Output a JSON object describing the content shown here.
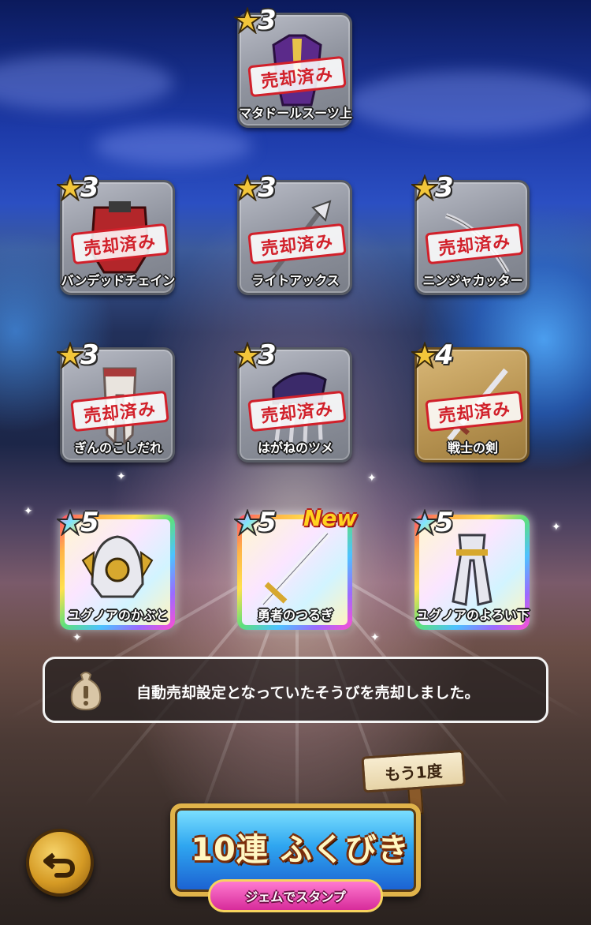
{
  "items": [
    {
      "id": "i0",
      "name": "マタドールスーツ上",
      "rarity": "3",
      "sold": true,
      "tier": "silver"
    },
    {
      "id": "i1",
      "name": "バンデッドチェイン",
      "rarity": "3",
      "sold": true,
      "tier": "silver"
    },
    {
      "id": "i2",
      "name": "ライトアックス",
      "rarity": "3",
      "sold": true,
      "tier": "silver"
    },
    {
      "id": "i3",
      "name": "ニンジャカッター",
      "rarity": "3",
      "sold": true,
      "tier": "silver"
    },
    {
      "id": "i4",
      "name": "ぎんのこしだれ",
      "rarity": "3",
      "sold": true,
      "tier": "silver"
    },
    {
      "id": "i5",
      "name": "はがねのツメ",
      "rarity": "3",
      "sold": true,
      "tier": "silver"
    },
    {
      "id": "i6",
      "name": "戦士の剣",
      "rarity": "4",
      "sold": true,
      "tier": "gold"
    },
    {
      "id": "i7",
      "name": "ユグノアのかぶと",
      "rarity": "5",
      "sold": false,
      "tier": "rainbow"
    },
    {
      "id": "i8",
      "name": "勇者のつるぎ",
      "rarity": "5",
      "sold": false,
      "tier": "rainbow",
      "new": "New"
    },
    {
      "id": "i9",
      "name": "ユグノアのよろい下",
      "rarity": "5",
      "sold": false,
      "tier": "rainbow"
    }
  ],
  "sold_stamp": "売却済み",
  "notice": {
    "text": "自動売却設定となっていたそうびを売却しました。"
  },
  "sign": {
    "label": "もう1度"
  },
  "gacha": {
    "label": "10連 ふくびき",
    "sub_label": "ジェムでスタンプ"
  },
  "colors": {
    "stamp_red": "#d1202a",
    "gold_frame": "#e0b34a",
    "button_blue": "#2fa6f0"
  },
  "icons": {
    "back": "back-arrow-icon",
    "notice": "bag-warning-icon",
    "star": "star-icon"
  }
}
